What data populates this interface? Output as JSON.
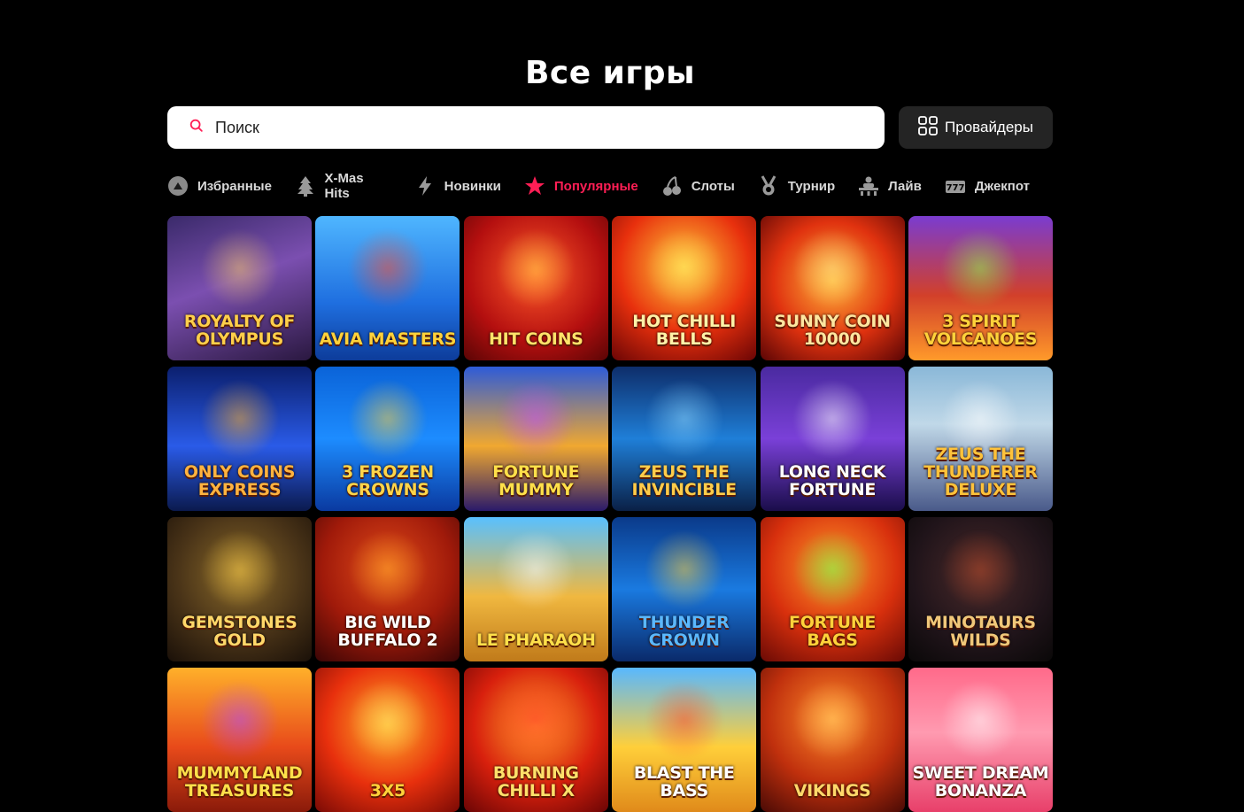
{
  "title": "Все игры",
  "search": {
    "placeholder": "Поиск"
  },
  "providers_button": "Провайдеры",
  "categories": [
    {
      "label": "Избранные",
      "icon": "favorite-icon",
      "active": false
    },
    {
      "label": "X-Mas Hits",
      "icon": "christmas-tree-icon",
      "active": false
    },
    {
      "label": "Новинки",
      "icon": "lightning-icon",
      "active": false
    },
    {
      "label": "Популярные",
      "icon": "star-icon",
      "active": true
    },
    {
      "label": "Слоты",
      "icon": "cherries-icon",
      "active": false
    },
    {
      "label": "Турнир",
      "icon": "medal-icon",
      "active": false
    },
    {
      "label": "Лайв",
      "icon": "dealer-icon",
      "active": false
    },
    {
      "label": "Джекпот",
      "icon": "jackpot-777-icon",
      "active": false
    }
  ],
  "colors": {
    "accent": "#ff1e55",
    "background": "#000000",
    "providers_bg": "#242424"
  },
  "games": [
    {
      "name": "Royalty of Olympus",
      "bg": "linear-gradient(160deg,#3a2a6a,#7b4fb0 45%,#2a1840)",
      "glow": "#f5c76a",
      "text": "#ffcf4a"
    },
    {
      "name": "Avia Masters",
      "bg": "linear-gradient(180deg,#4fb6ff,#1f6fe0 60%,#0d3c9a)",
      "glow": "#ff4b2b",
      "text": "#ffd23a"
    },
    {
      "name": "Hit Coins",
      "bg": "radial-gradient(circle at 50% 40%,#ff5a2a,#b40f0f 60%,#5a0505)",
      "glow": "#ffd34a",
      "text": "#ffe36a"
    },
    {
      "name": "Hot Chilli Bells",
      "bg": "radial-gradient(circle at 50% 35%,#ffcc3a,#e8300d 55%,#6a0505)",
      "glow": "#ffe066",
      "text": "#fff2a8"
    },
    {
      "name": "Sunny Coin 10000",
      "bg": "radial-gradient(circle at 50% 45%,#ffb43a,#e0320f 55%,#5a0505)",
      "glow": "#ffe88a",
      "text": "#ffe6a0"
    },
    {
      "name": "3 Spirit Volcanoes",
      "bg": "linear-gradient(180deg,#7a3cd0,#d2402a 55%,#ff9a2a)",
      "glow": "#8dff4a",
      "text": "#ffd23a"
    },
    {
      "name": "Only Coins Express",
      "bg": "linear-gradient(180deg,#0b1f6e,#2a5be8 55%,#0b1a4e)",
      "glow": "#ffb12a",
      "text": "#ffb340"
    },
    {
      "name": "3 Frozen Crowns",
      "bg": "linear-gradient(180deg,#0a63d8,#1d8cff 50%,#0a3aa0)",
      "glow": "#ffcf3a",
      "text": "#ffd54a"
    },
    {
      "name": "Fortune Mummy",
      "bg": "linear-gradient(180deg,#2d5bd8,#f0a830 55%,#2a1a6a)",
      "glow": "#c14dff",
      "text": "#ffe04a"
    },
    {
      "name": "Zeus The Invincible",
      "bg": "linear-gradient(180deg,#0e2d6a,#1f7fd8 50%,#0a2046)",
      "glow": "#8fd8ff",
      "text": "#ffcc4a"
    },
    {
      "name": "Long Neck Fortune",
      "bg": "linear-gradient(180deg,#4a2aa0,#7a40d8 50%,#1a0d4a)",
      "glow": "#ffffff",
      "text": "#ffffff"
    },
    {
      "name": "Zeus The Thunderer Deluxe",
      "bg": "linear-gradient(180deg,#8ab8d8,#c0d8e8 40%,#4a5a8a)",
      "glow": "#ffffff",
      "text": "#ffc23a"
    },
    {
      "name": "Gemstones Gold",
      "bg": "radial-gradient(circle at 50% 40%,#8a6a2a,#4a3418 55%,#1a1008)",
      "glow": "#ffd04a",
      "text": "#ffd86a"
    },
    {
      "name": "Big Wild Buffalo 2",
      "bg": "radial-gradient(circle at 50% 35%,#e04a1a,#a01a0a 55%,#3a0505)",
      "glow": "#ffb02a",
      "text": "#ffffff"
    },
    {
      "name": "Le Pharaoh",
      "bg": "linear-gradient(180deg,#58c0ff,#f0b840 55%,#c07a1a)",
      "glow": "#ffffff",
      "text": "#ffe04a"
    },
    {
      "name": "Thunder Crown",
      "bg": "linear-gradient(180deg,#0a3a8a,#1a7ae0 50%,#0a2a6a)",
      "glow": "#ffcf3a",
      "text": "#5ab8ff"
    },
    {
      "name": "Fortune Bags",
      "bg": "radial-gradient(circle at 50% 35%,#ff9a2a,#d8300d 55%,#6a0a05)",
      "glow": "#6aff4a",
      "text": "#ffd23a"
    },
    {
      "name": "Minotaurs Wilds",
      "bg": "radial-gradient(circle at 50% 40%,#4a2a2a,#20141a 60%,#0a0808)",
      "glow": "#b84a2a",
      "text": "#f0c87a"
    },
    {
      "name": "Mummyland Treasures",
      "bg": "linear-gradient(180deg,#ffb02a,#e84a1a 55%,#8a1a0a)",
      "glow": "#b04aff",
      "text": "#ffe04a"
    },
    {
      "name": "3x5",
      "bg": "radial-gradient(circle at 50% 40%,#ffb02a,#e8300d 55%,#7a0a05)",
      "glow": "#ffe06a",
      "text": "#ffd23a"
    },
    {
      "name": "Burning Chilli X",
      "bg": "radial-gradient(circle at 50% 40%,#ffa02a,#d8200d 55%,#6a0505)",
      "glow": "#ff2a2a",
      "text": "#ffe06a"
    },
    {
      "name": "Blast The Bass",
      "bg": "linear-gradient(180deg,#58b8ff,#ffcf3a 55%,#e08a1a)",
      "glow": "#ff4a2a",
      "text": "#ffffff"
    },
    {
      "name": "Vikings",
      "bg": "radial-gradient(circle at 50% 35%,#ff8a2a,#c0300d 55%,#4a0a05)",
      "glow": "#ffd06a",
      "text": "#ffd86a"
    },
    {
      "name": "Sweet Dream Bonanza",
      "bg": "linear-gradient(180deg,#ff6a8a,#ff9ab0 45%,#e8406a)",
      "glow": "#ffffff",
      "text": "#ffffff"
    }
  ]
}
